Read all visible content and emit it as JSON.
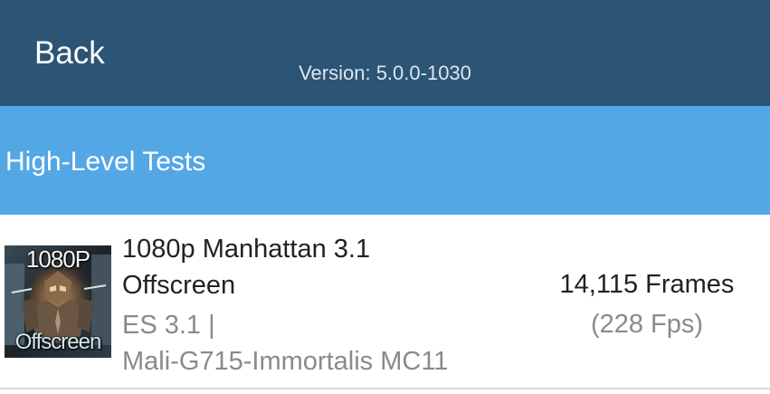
{
  "header": {
    "back_label": "Back",
    "version_text": "Version: 5.0.0-1030",
    "background_color": "#2c5474"
  },
  "section": {
    "title": "High-Level Tests",
    "background_color": "#54a7e5"
  },
  "results": [
    {
      "thumbnail": {
        "top_label": "1080P",
        "bottom_label": "Offscreen",
        "icon": "manhattan-robot-thumbnail"
      },
      "name_line1": "1080p Manhattan 3.1",
      "name_line2": "Offscreen",
      "api": "ES 3.1 |",
      "gpu": "Mali-G715-Immortalis MC11",
      "score": "14,115 Frames",
      "fps": "(228 Fps)"
    }
  ]
}
